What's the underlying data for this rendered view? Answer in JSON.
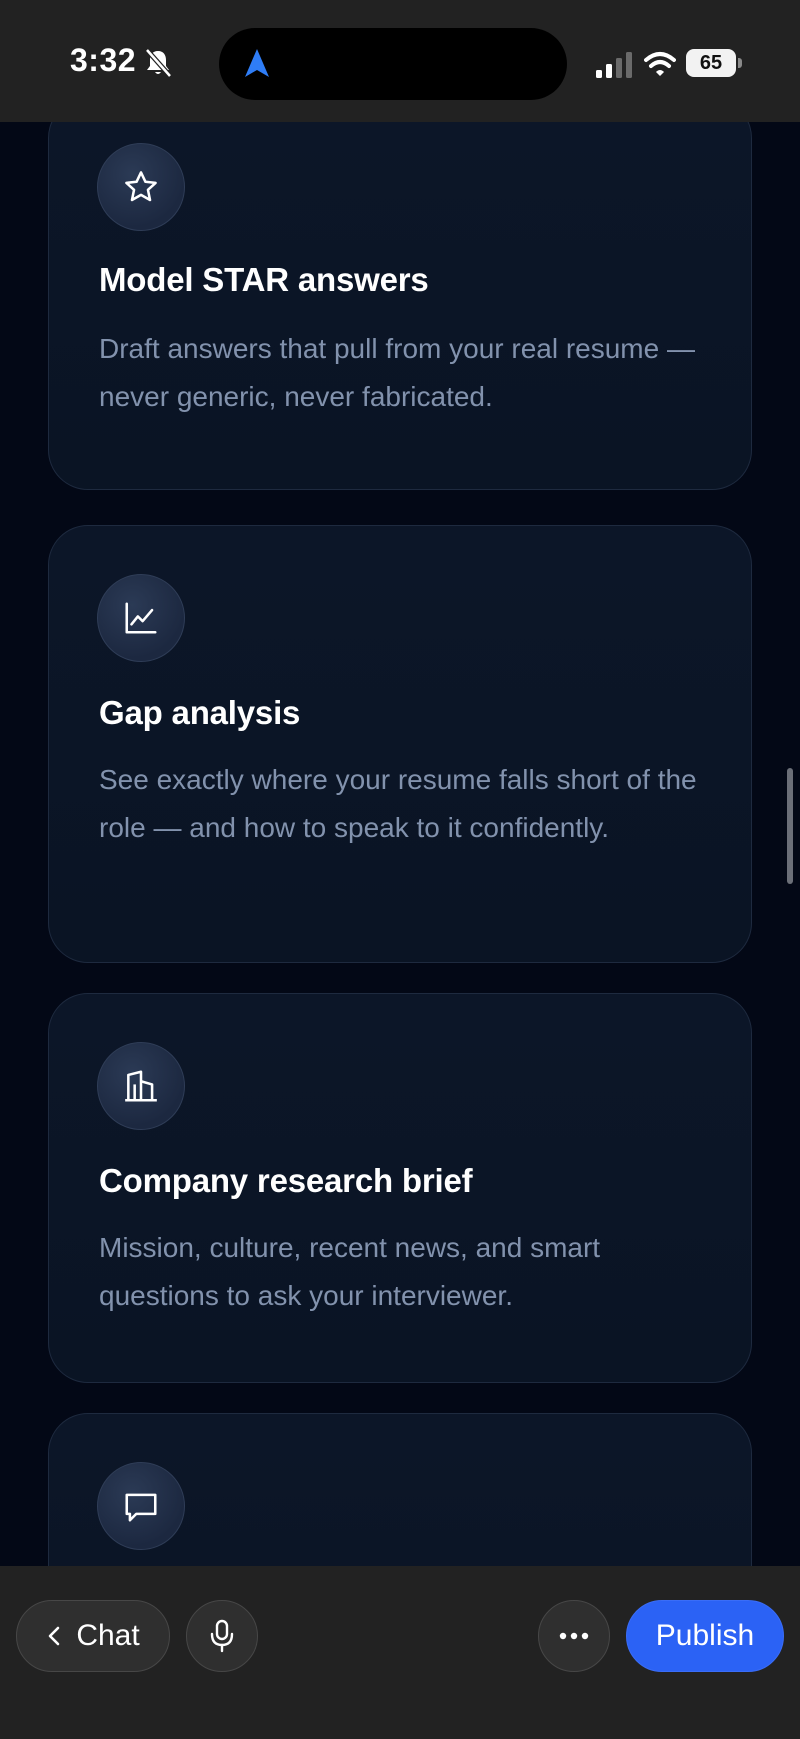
{
  "status_bar": {
    "time": "3:32",
    "battery": "65",
    "icons": [
      "bell-slash-icon",
      "location-arrow-icon",
      "signal-icon",
      "wifi-icon",
      "battery-icon"
    ]
  },
  "cards": [
    {
      "icon": "star-icon",
      "title": "Model STAR answers",
      "description": "Draft answers that pull from your real resume — never generic, never fabricated."
    },
    {
      "icon": "chart-line-icon",
      "title": "Gap analysis",
      "description": "See exactly where your resume falls short of the role — and how to speak to it confidently."
    },
    {
      "icon": "building-icon",
      "title": "Company research brief",
      "description": "Mission, culture, recent news, and smart questions to ask your interviewer."
    },
    {
      "icon": "message-square-icon",
      "title": "",
      "description": ""
    }
  ],
  "bottom_bar": {
    "chat_label": "Chat",
    "publish_label": "Publish"
  },
  "colors": {
    "background": "#030816",
    "card": "#0c1628",
    "card_border": "#1e2a3f",
    "description": "#8292ad",
    "accent": "#2b62f5",
    "bars": "#222222"
  }
}
